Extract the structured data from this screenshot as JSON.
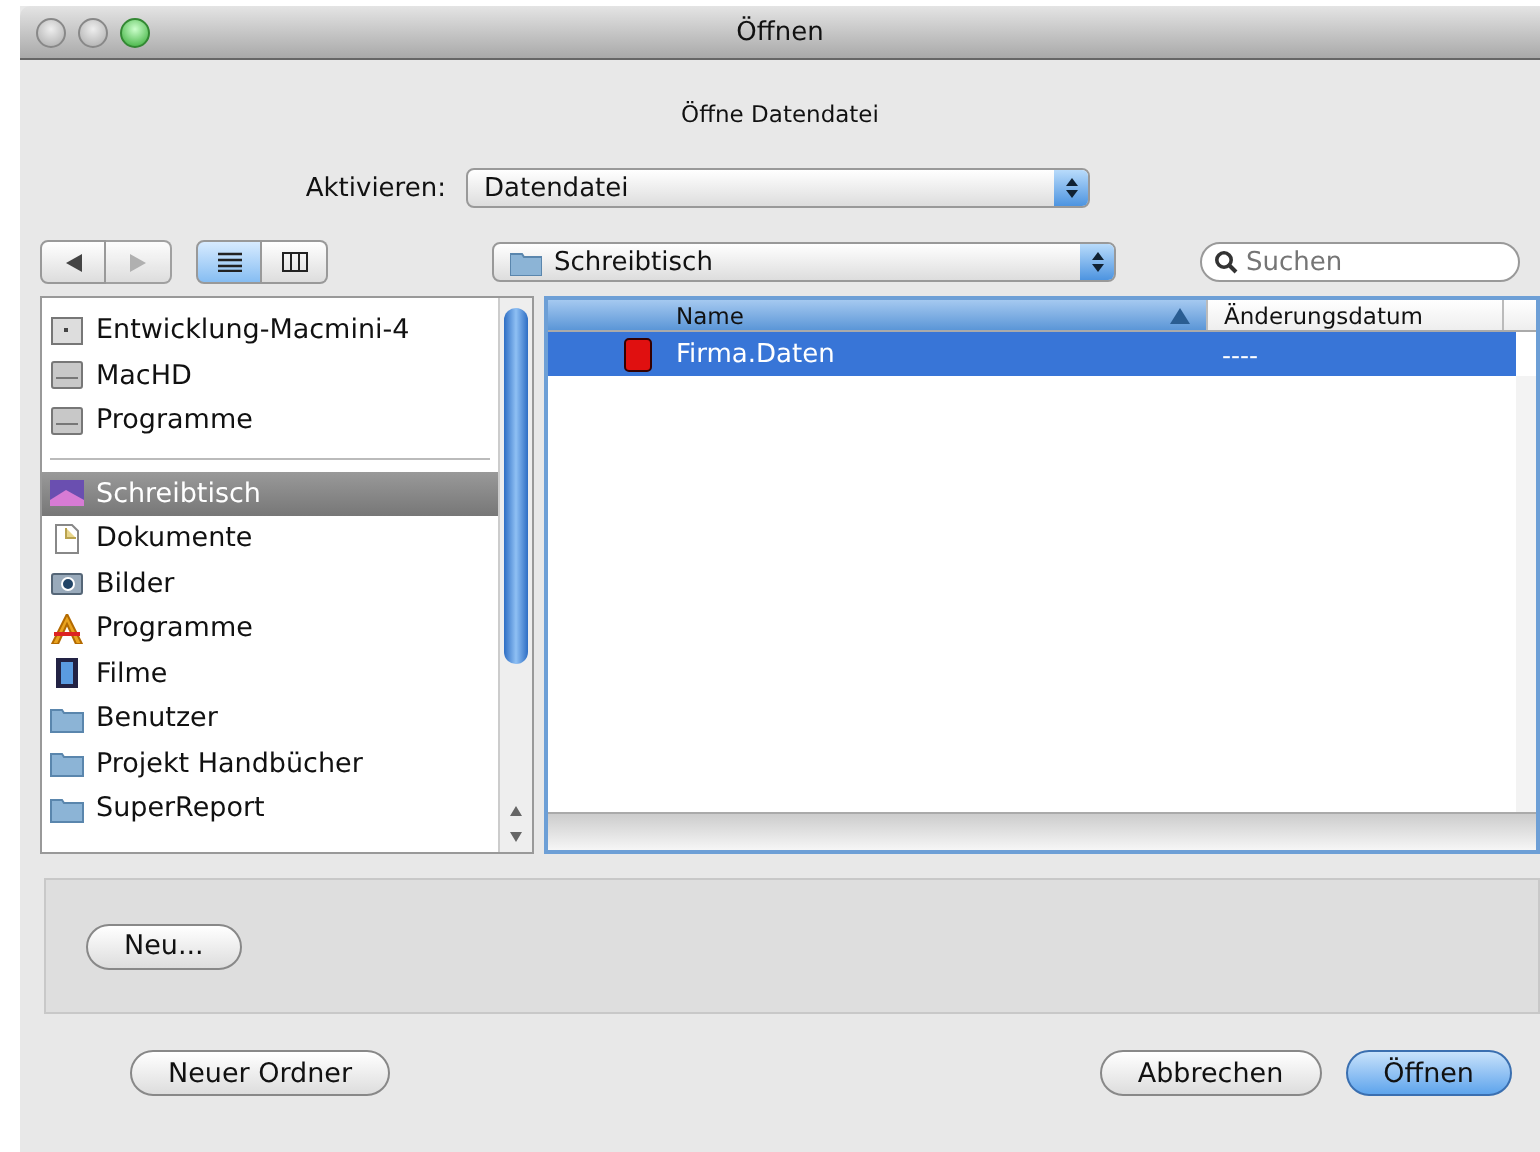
{
  "window": {
    "title": "Öffnen"
  },
  "message": "Öffne Datendatei",
  "format": {
    "label": "Aktivieren:",
    "value": "Datendatei"
  },
  "toolbar": {
    "back_disabled": false,
    "forward_disabled": true,
    "views": [
      {
        "kind": "list",
        "selected": true
      },
      {
        "kind": "columns",
        "selected": false
      }
    ],
    "location": "Schreibtisch",
    "search": {
      "placeholder": "Suchen"
    }
  },
  "sidebar": {
    "sections": [
      {
        "items": [
          {
            "label": "Entwicklung-Macmini-4",
            "kind": "server",
            "selected": false
          },
          {
            "label": "MacHD",
            "kind": "disk",
            "selected": false
          },
          {
            "label": "Programme",
            "kind": "disk",
            "selected": false
          }
        ]
      },
      {
        "items": [
          {
            "label": "Schreibtisch",
            "kind": "desktop",
            "selected": true
          },
          {
            "label": "Dokumente",
            "kind": "document",
            "selected": false
          },
          {
            "label": "Bilder",
            "kind": "camera",
            "selected": false
          },
          {
            "label": "Programme",
            "kind": "apps",
            "selected": false
          },
          {
            "label": "Filme",
            "kind": "film",
            "selected": false
          },
          {
            "label": "Benutzer",
            "kind": "folder",
            "selected": false
          },
          {
            "label": "Projekt Handbücher",
            "kind": "folder",
            "selected": false
          },
          {
            "label": "SuperReport",
            "kind": "folder",
            "selected": false
          }
        ]
      }
    ]
  },
  "files": {
    "columns": [
      {
        "label": "Name",
        "sorted": true
      },
      {
        "label": "Änderungsdatum",
        "sorted": false
      }
    ],
    "rows": [
      {
        "name": "Firma.Daten",
        "date": "----",
        "selected": true
      }
    ]
  },
  "accessory": {
    "buttons": [
      "Neu..."
    ]
  },
  "buttons": {
    "new_folder": "Neuer Ordner",
    "cancel": "Abbrechen",
    "open": "Öffnen"
  }
}
